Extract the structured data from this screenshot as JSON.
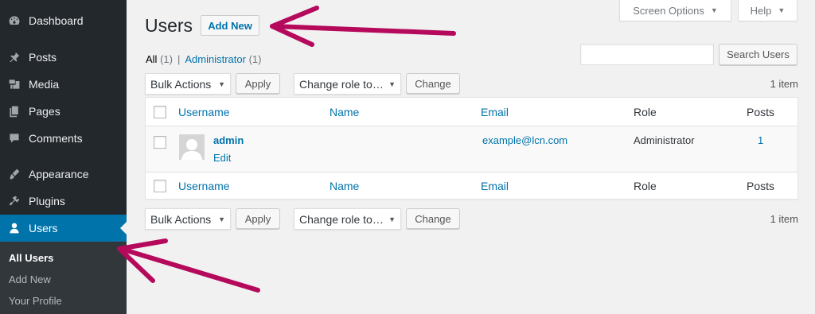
{
  "sidebar": {
    "items": [
      {
        "label": "Dashboard",
        "icon": "dashboard-icon"
      },
      {
        "label": "Posts",
        "icon": "pin-icon"
      },
      {
        "label": "Media",
        "icon": "media-icon"
      },
      {
        "label": "Pages",
        "icon": "pages-icon"
      },
      {
        "label": "Comments",
        "icon": "comment-icon"
      },
      {
        "label": "Appearance",
        "icon": "brush-icon"
      },
      {
        "label": "Plugins",
        "icon": "plug-icon"
      },
      {
        "label": "Users",
        "icon": "user-icon",
        "active": true
      }
    ],
    "submenu": [
      "All Users",
      "Add New",
      "Your Profile"
    ]
  },
  "header": {
    "title": "Users",
    "add_new": "Add New",
    "screen_options": "Screen Options",
    "help": "Help"
  },
  "filters": {
    "all_label": "All",
    "all_count": "(1)",
    "separator": "|",
    "admin_label": "Administrator",
    "admin_count": "(1)"
  },
  "search": {
    "button": "Search Users",
    "value": ""
  },
  "bulk": {
    "actions_label": "Bulk Actions",
    "apply": "Apply",
    "role_label": "Change role to…",
    "change": "Change",
    "count": "1 item"
  },
  "table": {
    "columns": [
      "Username",
      "Name",
      "Email",
      "Role",
      "Posts"
    ],
    "rows": [
      {
        "username": "admin",
        "edit": "Edit",
        "name": "",
        "email": "example@lcn.com",
        "role": "Administrator",
        "posts": "1"
      }
    ]
  },
  "colors": {
    "sidebar_bg": "#23282d",
    "active_bg": "#0073aa",
    "link": "#0073aa",
    "annotation_arrow": "#b5095c"
  }
}
